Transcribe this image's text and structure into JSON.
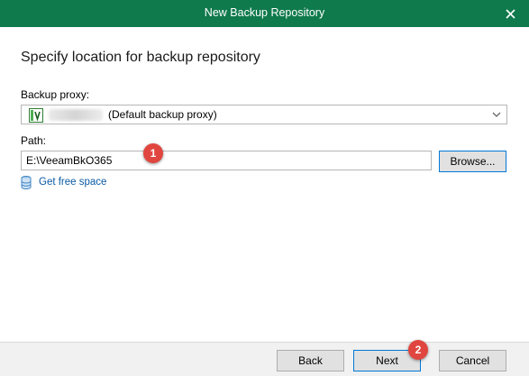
{
  "window": {
    "title": "New Backup Repository"
  },
  "page": {
    "heading": "Specify location for backup repository"
  },
  "proxy": {
    "label": "Backup proxy:",
    "selected_value": "(Default backup proxy)"
  },
  "path": {
    "label": "Path:",
    "value": "E:\\VeeamBkO365",
    "browse_label": "Browse..."
  },
  "get_free_space": {
    "label": "Get free space"
  },
  "footer": {
    "back_label": "Back",
    "next_label": "Next",
    "cancel_label": "Cancel"
  },
  "annotations": {
    "step1": "1",
    "step2": "2"
  },
  "icons": {
    "close": "close-icon",
    "proxy": "veeam-server-icon",
    "dropdown": "chevron-down-icon",
    "get_free_space": "database-icon"
  },
  "colors": {
    "titlebar": "#0f7a4c",
    "link": "#0a5aa5",
    "focus_border": "#0078d7",
    "badge": "#e0463f"
  }
}
